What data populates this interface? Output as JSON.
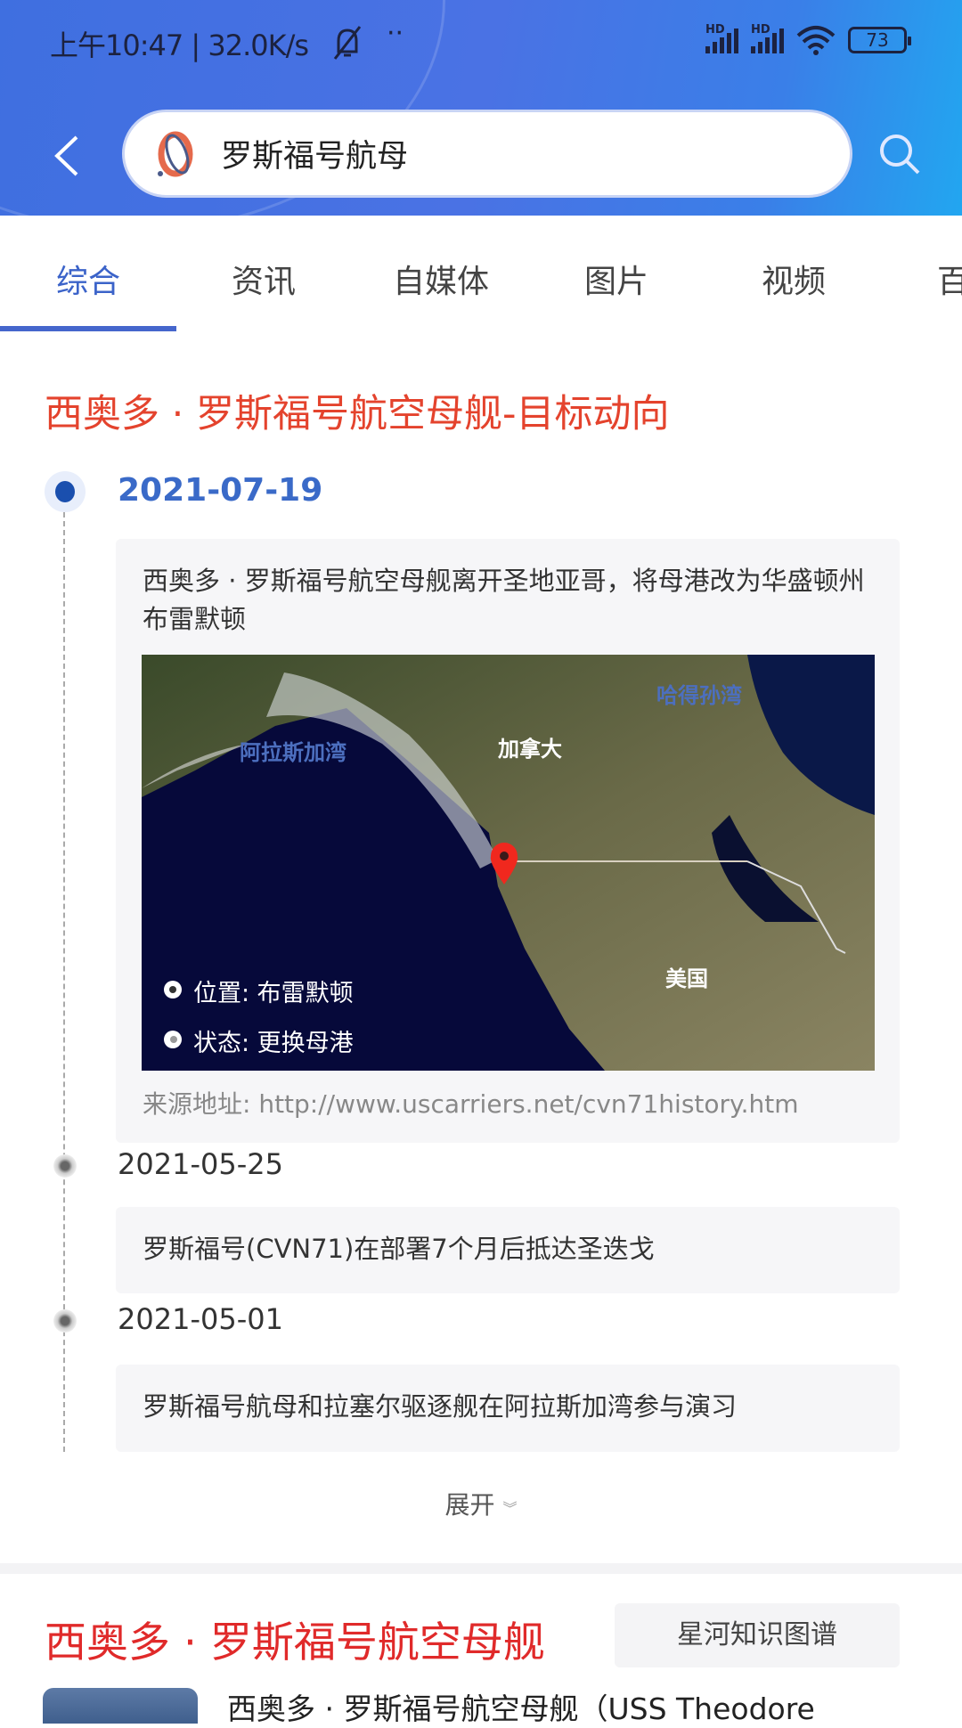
{
  "status_bar": {
    "time_speed": "上午10:47 | 32.0K/s",
    "signal1": "HD",
    "signal2": "HD",
    "battery": "73"
  },
  "search": {
    "query": "罗斯福号航母"
  },
  "tabs": [
    {
      "label": "综合",
      "active": true
    },
    {
      "label": "资讯"
    },
    {
      "label": "自媒体"
    },
    {
      "label": "图片"
    },
    {
      "label": "视频"
    },
    {
      "label": "百"
    }
  ],
  "timeline": {
    "title": "西奥多 · 罗斯福号航空母舰-目标动向",
    "events": [
      {
        "date": "2021-07-19",
        "text": "西奥多 · 罗斯福号航空母舰离开圣地亚哥，将母港改为华盛顿州布雷默顿",
        "map": {
          "labels": {
            "gulf_alaska": "阿拉斯加湾",
            "hudson": "哈得孙湾",
            "canada": "加拿大",
            "usa": "美国"
          },
          "location": "位置: 布雷默顿",
          "status": "状态: 更换母港"
        },
        "source": "来源地址: http://www.uscarriers.net/cvn71history.htm"
      },
      {
        "date": "2021-05-25",
        "text": "罗斯福号(CVN71)在部署7个月后抵达圣迭戈"
      },
      {
        "date": "2021-05-01",
        "text": "罗斯福号航母和拉塞尔驱逐舰在阿拉斯加湾参与演习"
      }
    ],
    "expand_label": "展开"
  },
  "knowledge": {
    "title": "西奥多 · 罗斯福号航空母舰",
    "graph_button": "星河知识图谱",
    "first_item": "西奥多 · 罗斯福号航空母舰（USS Theodore"
  },
  "colors": {
    "accent": "#3b63c9",
    "title_red": "#e4432d",
    "header_blue": "#4a72e4"
  }
}
